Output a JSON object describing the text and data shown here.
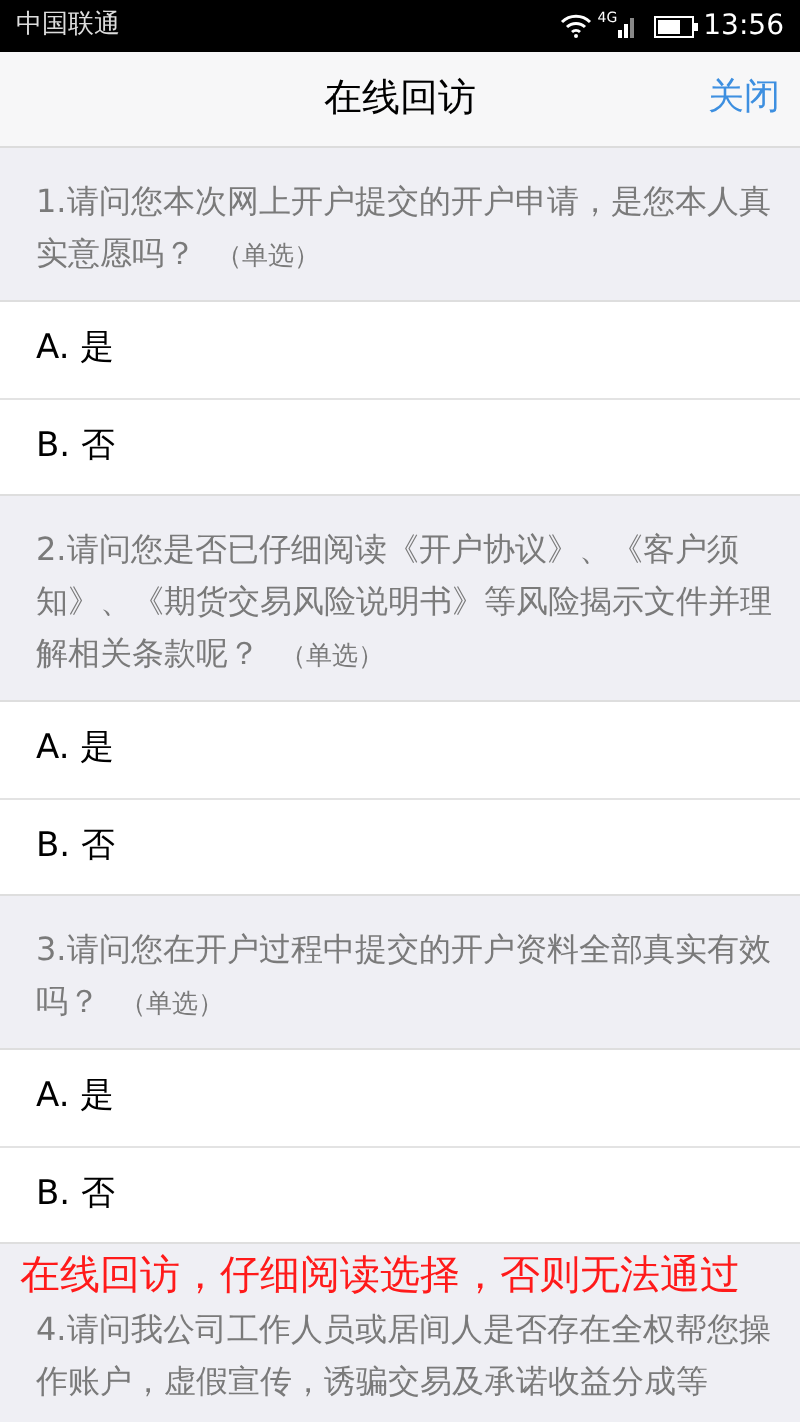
{
  "status_bar": {
    "carrier": "中国联通",
    "network": "4G",
    "time": "13:56"
  },
  "header": {
    "title": "在线回访",
    "close": "关闭"
  },
  "questions": [
    {
      "text": "1.请问您本次网上开户提交的开户申请，是您本人真实意愿吗？",
      "tag": "（单选）",
      "options": [
        "A. 是",
        "B. 否"
      ]
    },
    {
      "text": "2.请问您是否已仔细阅读《开户协议》、《客户须知》、《期货交易风险说明书》等风险揭示文件并理解相关条款呢？",
      "tag": "（单选）",
      "options": [
        "A. 是",
        "B. 否"
      ]
    },
    {
      "text": "3.请问您在开户过程中提交的开户资料全部真实有效吗？",
      "tag": "（单选）",
      "options": [
        "A. 是",
        "B. 否"
      ]
    },
    {
      "caption": "在线回访，仔细阅读选择，否则无法通过",
      "text": "4.请问我公司工作人员或居间人是否存在全权帮您操作账户，虚假宣传，诱骗交易及承诺收益分成等"
    }
  ]
}
